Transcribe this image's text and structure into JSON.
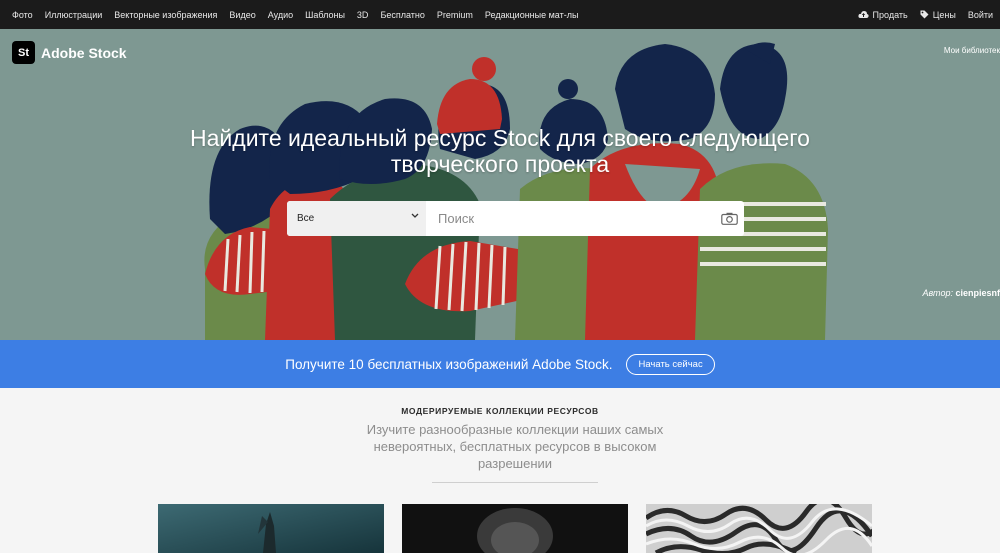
{
  "topnav": {
    "items": [
      "Фото",
      "Иллюстрации",
      "Векторные изображения",
      "Видео",
      "Аудио",
      "Шаблоны",
      "3D",
      "Бесплатно",
      "Premium",
      "Редакционные мат-лы"
    ],
    "sell": "Продать",
    "pricing": "Цены",
    "signin": "Войти"
  },
  "hero": {
    "logo_badge": "St",
    "logo_name": "Adobe Stock",
    "my_libraries": "Мои библиотек",
    "headline_line1": "Найдите идеальный ресурс Stock для своего следующего",
    "headline_line2": "творческого проекта",
    "author_label": "Автор:",
    "author_name": "cienpiesnf"
  },
  "search": {
    "category": "Все",
    "placeholder": "Поиск"
  },
  "promo": {
    "text": "Получите 10 бесплатных изображений Adobe Stock.",
    "button": "Начать сейчас"
  },
  "collections": {
    "kicker": "МОДЕРИРУЕМЫЕ КОЛЛЕКЦИИ РЕСУРСОВ",
    "description": "Изучите разнообразные коллекции наших самых невероятных, бесплатных ресурсов в высоком разрешении"
  },
  "colors": {
    "hero_bg": "#7e9892",
    "navy": "#13254a",
    "red": "#c0302a",
    "green": "#6b8a4a",
    "dark_green": "#2f5640",
    "promo_blue": "#3d7ee4"
  }
}
